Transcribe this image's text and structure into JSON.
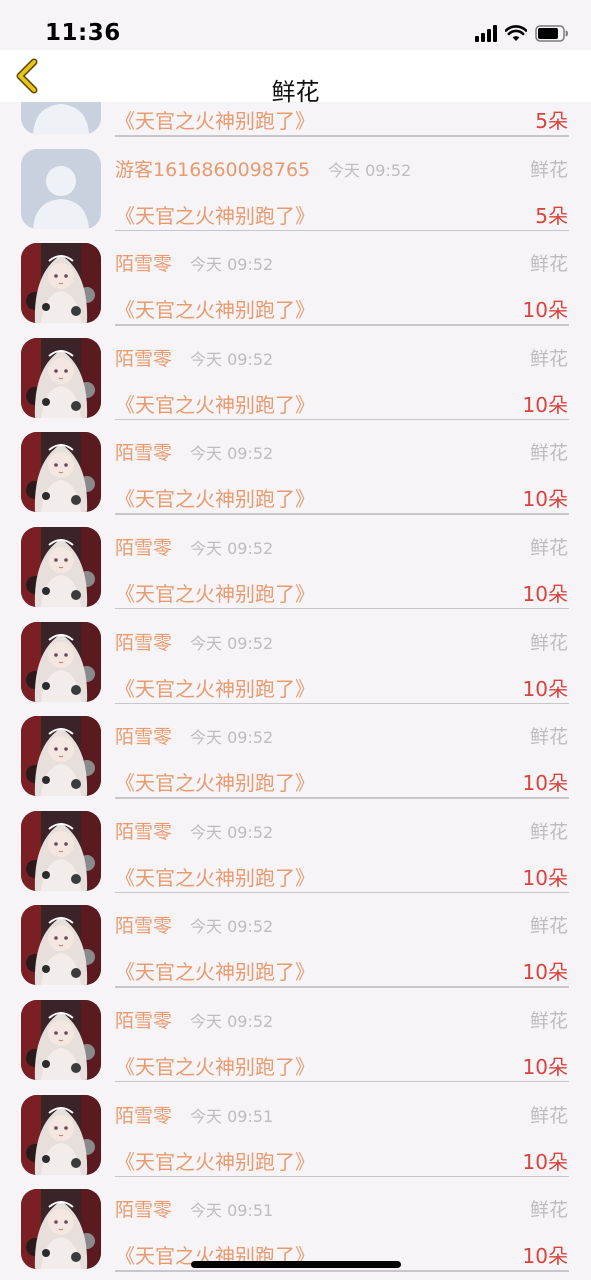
{
  "status_bar": {
    "time": "11:36"
  },
  "nav": {
    "title": "鲜花",
    "back_icon": "chevron-left-icon"
  },
  "records": [
    {
      "avatar": "placeholder",
      "name": "",
      "time": "",
      "type": "",
      "book": "《天官之火神别跑了》",
      "count": "5朵"
    },
    {
      "avatar": "placeholder",
      "name": "游客1616860098765",
      "time": "今天 09:52",
      "type": "鲜花",
      "book": "《天官之火神别跑了》",
      "count": "5朵"
    },
    {
      "avatar": "anime",
      "name": "陌雪零",
      "time": "今天 09:52",
      "type": "鲜花",
      "book": "《天官之火神别跑了》",
      "count": "10朵"
    },
    {
      "avatar": "anime",
      "name": "陌雪零",
      "time": "今天 09:52",
      "type": "鲜花",
      "book": "《天官之火神别跑了》",
      "count": "10朵"
    },
    {
      "avatar": "anime",
      "name": "陌雪零",
      "time": "今天 09:52",
      "type": "鲜花",
      "book": "《天官之火神别跑了》",
      "count": "10朵"
    },
    {
      "avatar": "anime",
      "name": "陌雪零",
      "time": "今天 09:52",
      "type": "鲜花",
      "book": "《天官之火神别跑了》",
      "count": "10朵"
    },
    {
      "avatar": "anime",
      "name": "陌雪零",
      "time": "今天 09:52",
      "type": "鲜花",
      "book": "《天官之火神别跑了》",
      "count": "10朵"
    },
    {
      "avatar": "anime",
      "name": "陌雪零",
      "time": "今天 09:52",
      "type": "鲜花",
      "book": "《天官之火神别跑了》",
      "count": "10朵"
    },
    {
      "avatar": "anime",
      "name": "陌雪零",
      "time": "今天 09:52",
      "type": "鲜花",
      "book": "《天官之火神别跑了》",
      "count": "10朵"
    },
    {
      "avatar": "anime",
      "name": "陌雪零",
      "time": "今天 09:52",
      "type": "鲜花",
      "book": "《天官之火神别跑了》",
      "count": "10朵"
    },
    {
      "avatar": "anime",
      "name": "陌雪零",
      "time": "今天 09:52",
      "type": "鲜花",
      "book": "《天官之火神别跑了》",
      "count": "10朵"
    },
    {
      "avatar": "anime",
      "name": "陌雪零",
      "time": "今天 09:51",
      "type": "鲜花",
      "book": "《天官之火神别跑了》",
      "count": "10朵"
    },
    {
      "avatar": "anime",
      "name": "陌雪零",
      "time": "今天 09:51",
      "type": "鲜花",
      "book": "《天官之火神别跑了》",
      "count": "10朵"
    }
  ],
  "colors": {
    "accent": "#e89b6f",
    "count_red": "#d9433b",
    "muted": "#bdbdbd",
    "back_icon": "#e6c21a"
  }
}
